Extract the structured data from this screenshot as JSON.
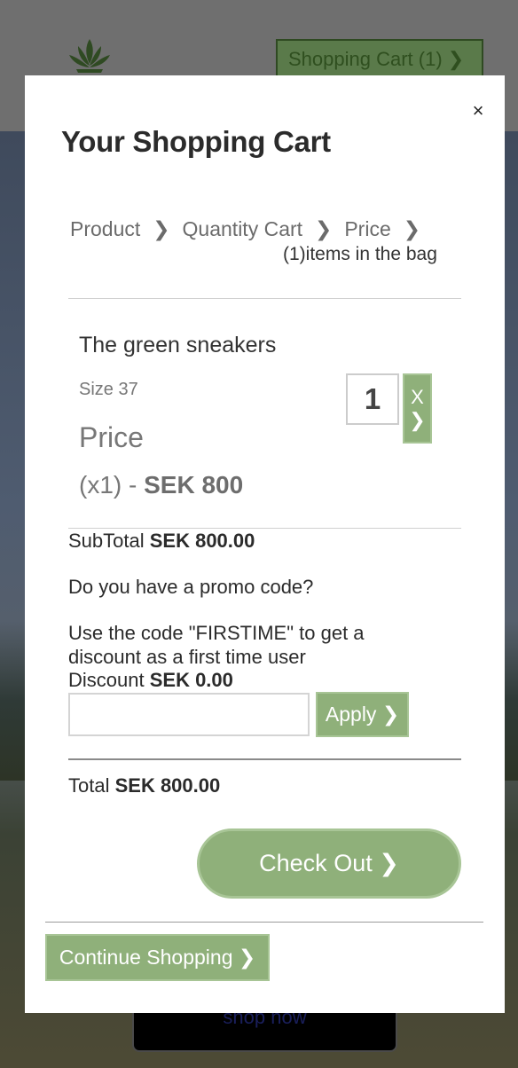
{
  "background": {
    "header_cart_label": "Shopping Cart (1) ❯",
    "hero_button_label": "shop now"
  },
  "modal": {
    "close_label": "×",
    "title": "Your Shopping Cart",
    "breadcrumb": {
      "product": "Product",
      "quantity": "Quantity Cart",
      "price": "Price",
      "separator": "❯"
    },
    "items_count": "(1)items in the bag",
    "item": {
      "name": "The green sneakers",
      "size": "Size 37",
      "price_label": "Price",
      "qty_prefix": "(x1) - ",
      "price_value": "SEK 800",
      "quantity": "1",
      "remove_label": "X ❯"
    },
    "subtotal": {
      "label": "SubTotal ",
      "value": "SEK 800.00"
    },
    "promo": {
      "question": "Do you have a promo code?",
      "hint": "Use the code \"FIRSTIME\" to get a discount as a first time user",
      "input_value": "",
      "input_placeholder": "",
      "apply_label": "Apply ❯"
    },
    "discount": {
      "label": "Discount ",
      "value": "SEK 0.00"
    },
    "total": {
      "label": "Total ",
      "value": "SEK 800.00"
    },
    "checkout_label": "Check Out ❯",
    "continue_label": "Continue Shopping ❯"
  },
  "colors": {
    "accent_green": "#8fb07a",
    "accent_border": "#a8c596",
    "overlay_gray": "#6f6f6f"
  }
}
